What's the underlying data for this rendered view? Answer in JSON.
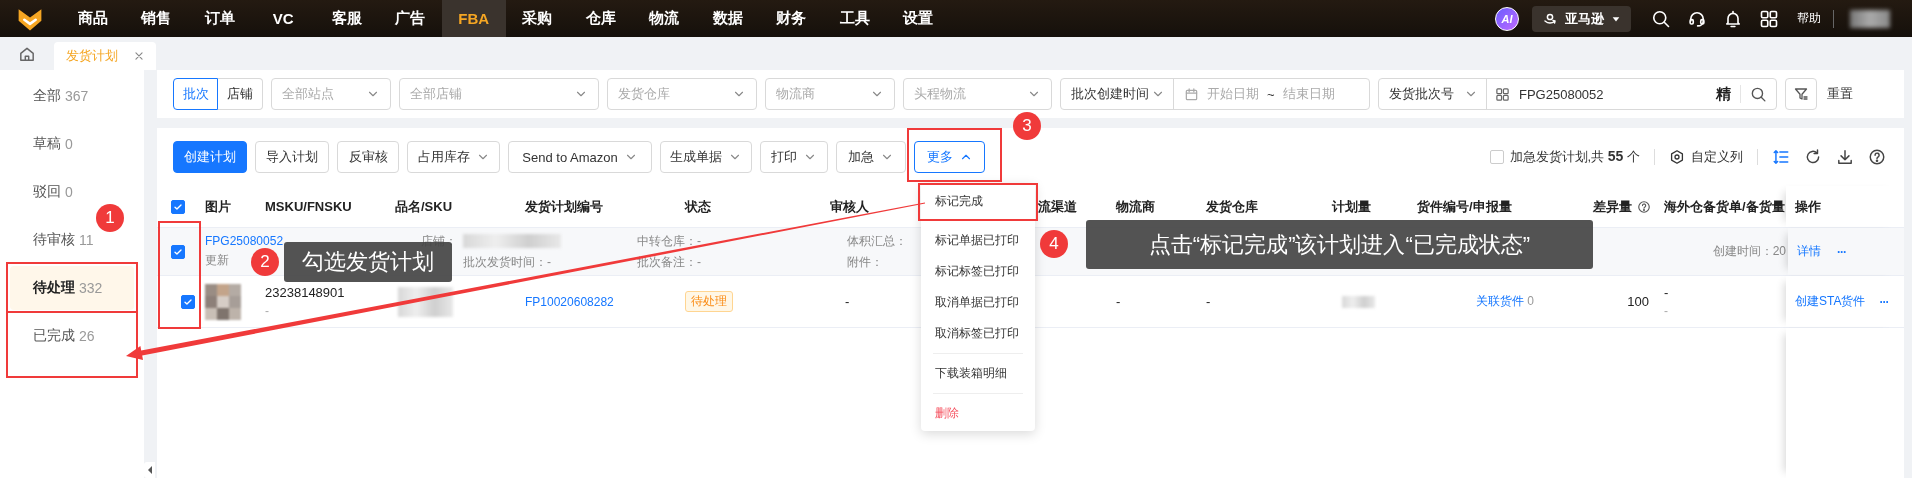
{
  "top_nav": {
    "menu": [
      {
        "label": "商品",
        "selected": false
      },
      {
        "label": "销售",
        "selected": false
      },
      {
        "label": "订单",
        "selected": false
      },
      {
        "label": "VC",
        "selected": false
      },
      {
        "label": "客服",
        "selected": false
      },
      {
        "label": "广告",
        "selected": false
      },
      {
        "label": "FBA",
        "selected": true
      },
      {
        "label": "采购",
        "selected": false
      },
      {
        "label": "仓库",
        "selected": false
      },
      {
        "label": "物流",
        "selected": false
      },
      {
        "label": "数据",
        "selected": false
      },
      {
        "label": "财务",
        "selected": false
      },
      {
        "label": "工具",
        "selected": false
      },
      {
        "label": "设置",
        "selected": false
      }
    ],
    "ai_badge": "AI",
    "marketplace": "亚马逊",
    "help": "帮助"
  },
  "tabs": [
    {
      "label": "发货计划",
      "selected": true
    }
  ],
  "sidebar": {
    "items": [
      {
        "label": "全部",
        "count": "367",
        "selected": false
      },
      {
        "label": "草稿",
        "count": "0",
        "selected": false
      },
      {
        "label": "驳回",
        "count": "0",
        "selected": false
      },
      {
        "label": "待审核",
        "count": "11",
        "selected": false
      },
      {
        "label": "待处理",
        "count": "332",
        "selected": true
      },
      {
        "label": "已完成",
        "count": "26",
        "selected": false
      }
    ]
  },
  "filters": {
    "scope_toggle": [
      {
        "label": "批次",
        "selected": true
      },
      {
        "label": "店铺",
        "selected": false
      }
    ],
    "selects": [
      {
        "placeholder": "全部站点"
      },
      {
        "placeholder": "全部店铺"
      },
      {
        "placeholder": "发货仓库"
      },
      {
        "placeholder": "物流商"
      },
      {
        "placeholder": "头程物流"
      }
    ],
    "date_filter": {
      "type": "批次创建时间",
      "start_placeholder": "开始日期",
      "separator": "~",
      "end_placeholder": "结束日期"
    },
    "search": {
      "type": "发货批次号",
      "value": "FPG25080052",
      "exact_label": "精"
    },
    "reset": "重置"
  },
  "toolbar": {
    "buttons": [
      {
        "label": "创建计划",
        "kind": "primary"
      },
      {
        "label": "导入计划",
        "kind": "plain"
      },
      {
        "label": "反审核",
        "kind": "plain"
      },
      {
        "label": "占用库存",
        "kind": "dropdown",
        "expanded": false
      },
      {
        "label": "Send to Amazon",
        "kind": "dropdown",
        "expanded": false
      },
      {
        "label": "生成单据",
        "kind": "dropdown",
        "expanded": false
      },
      {
        "label": "打印",
        "kind": "dropdown",
        "expanded": false
      },
      {
        "label": "加急",
        "kind": "dropdown",
        "expanded": false
      },
      {
        "label": "更多",
        "kind": "dropdown",
        "expanded": true
      }
    ],
    "urgent_filter": {
      "checked": false,
      "label": "加急发货计划,共 **55** 个"
    },
    "custom_columns": "自定义列"
  },
  "table": {
    "header_checked": true,
    "columns": [
      {
        "label": "图片"
      },
      {
        "label": "MSKU/FNSKU"
      },
      {
        "label": "品名/SKU"
      },
      {
        "label": "发货计划编号"
      },
      {
        "label": "状态"
      },
      {
        "label": "审核人"
      },
      {
        "label": "流渠道"
      },
      {
        "label": "物流商"
      },
      {
        "label": "发货仓库"
      },
      {
        "label": "计划量"
      },
      {
        "label": "货件编号/申报量"
      },
      {
        "label": "差异量",
        "help": true
      },
      {
        "label": "海外仓备货单/备货量"
      },
      {
        "label": "操作"
      }
    ],
    "groups": [
      {
        "checked": true,
        "batch_no": "FPG25080052",
        "updated_label": "更新",
        "store_label": "店铺：",
        "ship_time": "批次发货时间：-",
        "transit_warehouse": "中转仓库：-",
        "batch_note": "批次备注：-",
        "volume_total": "体积汇总：",
        "attachment": "附件：",
        "created": "创建时间：20",
        "actions": [
          "详情",
          "···"
        ],
        "rows": [
          {
            "checked": true,
            "msku": "23238148901",
            "fnsku": "-",
            "plan_no": "FP10020608282",
            "status": "待处理",
            "reviewer": "-",
            "carrier": "-",
            "warehouse": "-",
            "shipment": "关联货件",
            "shipment_count": "0",
            "difference": "100",
            "overseas_order": "-",
            "overseas_qty": "-",
            "actions": [
              "创建STA货件",
              "···"
            ]
          }
        ]
      }
    ]
  },
  "dropdown_menu": {
    "items": [
      {
        "label": "标记完成",
        "kind": "normal",
        "divider_before": false
      },
      {
        "label": "标记单据已打印",
        "kind": "normal",
        "divider_before": false
      },
      {
        "label": "标记标签已打印",
        "kind": "normal",
        "divider_before": false
      },
      {
        "label": "取消单据已打印",
        "kind": "normal",
        "divider_before": false
      },
      {
        "label": "取消标签已打印",
        "kind": "normal",
        "divider_before": false
      },
      {
        "label": "下载装箱明细",
        "kind": "normal",
        "divider_before": true
      },
      {
        "label": "删除",
        "kind": "danger",
        "divider_before": true
      }
    ]
  },
  "annotations": {
    "steps": [
      {
        "number": "1"
      },
      {
        "number": "2"
      },
      {
        "number": "3"
      },
      {
        "number": "4"
      }
    ],
    "callouts": [
      {
        "text": "勾选发货计划"
      },
      {
        "text": "点击“标记完成”该计划进入“已完成状态”"
      }
    ]
  }
}
